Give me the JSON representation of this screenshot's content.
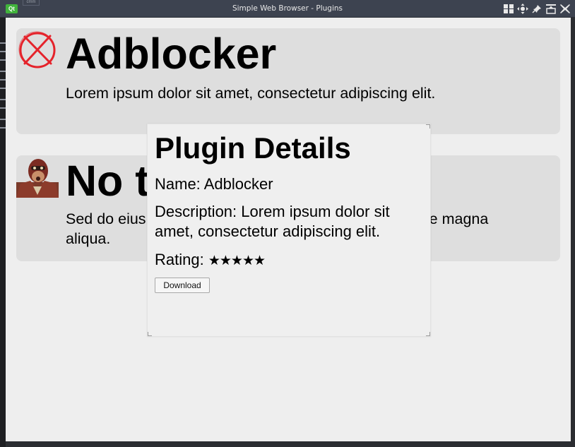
{
  "window": {
    "title": "Simple Web Browser - Plugins",
    "app_icon_text": "Qt",
    "background_tab_text": "cmm"
  },
  "plugins": [
    {
      "name": "Adblocker",
      "description": "Lorem ipsum dolor sit amet, consectetur adipiscing elit.",
      "icon": "crossed-circle-icon"
    },
    {
      "name": "No t",
      "description": "Sed do eius",
      "description_tail": "ore magna",
      "description_line2": "aliqua.",
      "icon": "spy-avatar-icon"
    }
  ],
  "dialog": {
    "title": "Plugin Details",
    "name_label": "Name: Adblocker",
    "description_label": "Description: Lorem ipsum dolor sit amet, consectetur adipiscing elit.",
    "rating_label": "Rating:",
    "rating_stars": "★★★★★",
    "rating_value": 5,
    "rating_max": 5,
    "download_label": "Download"
  },
  "colors": {
    "titlebar": "#3d4350",
    "content_bg": "#eeeeee",
    "card_bg": "#dedede",
    "dialog_bg": "#efefef"
  }
}
